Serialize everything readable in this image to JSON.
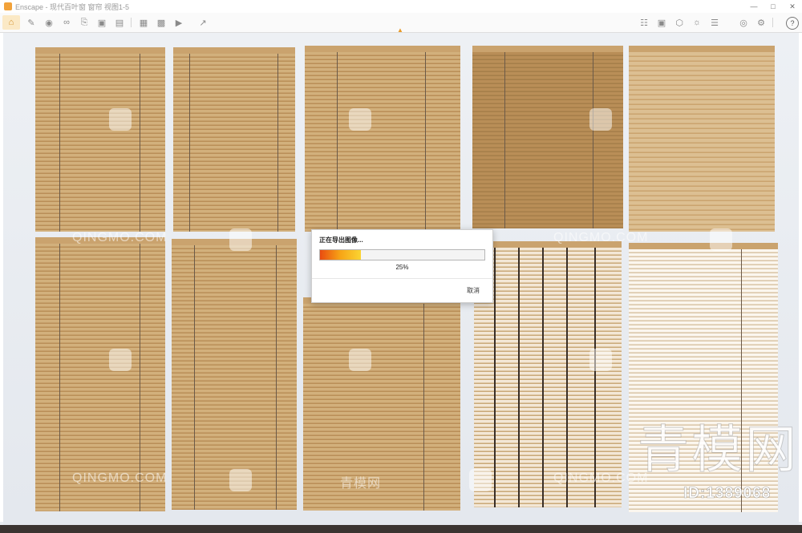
{
  "window": {
    "title": "Enscape - 现代百叶窗 窗帘 视图1-5"
  },
  "toolbar": {
    "left_icons": [
      "home-icon",
      "pencil-icon",
      "eye-icon",
      "link-icon",
      "paste-icon",
      "box-icon",
      "clapper-icon",
      "photo-icon",
      "batch-photo-icon",
      "video-export-icon",
      "export-icon"
    ],
    "right_icons": [
      "book-icon",
      "screenshot-icon",
      "cube-icon",
      "sun-icon",
      "layers-icon",
      "visibility-icon",
      "settings-icon",
      "help-icon"
    ],
    "help_label": "?"
  },
  "watermarks": {
    "latin": "QINGMO.COM",
    "cn": "青模网",
    "brand": "青模网",
    "id": "ID:1389068"
  },
  "dialog": {
    "title": "正在导出图像...",
    "progress": 0.25,
    "percent_label": "25%",
    "cancel_label": "取消"
  },
  "colors": {
    "accent": "#f2a23a",
    "slat": "#d2b07c",
    "slat_dark": "#b98e57",
    "slat_light": "#f3e7d6",
    "bar_start": "#e94b10",
    "bar_end": "#fbd432"
  }
}
